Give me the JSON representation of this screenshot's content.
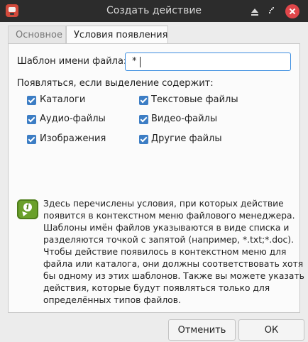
{
  "window": {
    "title": "Создать действие"
  },
  "tabs": [
    {
      "label": "Основное"
    },
    {
      "label": "Условия появления"
    }
  ],
  "filename_pattern": {
    "label": "Шаблон имени файла:",
    "value": "*"
  },
  "selection": {
    "heading": "Появляться, если выделение содержит:",
    "options": [
      {
        "label": "Каталоги",
        "checked": true
      },
      {
        "label": "Текстовые файлы",
        "checked": true
      },
      {
        "label": "Аудио-файлы",
        "checked": true
      },
      {
        "label": "Видео-файлы",
        "checked": true
      },
      {
        "label": "Изображения",
        "checked": true
      },
      {
        "label": "Другие файлы",
        "checked": true
      }
    ]
  },
  "help": {
    "icon": "info-icon",
    "lines": [
      "Здесь перечислены условия, при которых действие",
      "появится в контекстном меню файлового менеджера.",
      "Шаблоны имён файлов указываются в виде списка и",
      "разделяются точкой с запятой (например, *.txt;*.doc).",
      "Чтобы действие появилось в контекстном меню для",
      "файла или каталога, они должны соответствовать хотя",
      "бы одному из этих шаблонов. Также вы можете указать",
      "действия, которые будут появляться только для",
      "определённых типов файлов."
    ]
  },
  "buttons": {
    "cancel": "Отменить",
    "ok": "ОК"
  },
  "colors": {
    "titlebar": "#2c2c2c",
    "checkbox": "#3c7dc4",
    "focus_border": "#3d8ee0",
    "close_button": "#e0464a",
    "info_icon": "#6aa02b"
  }
}
